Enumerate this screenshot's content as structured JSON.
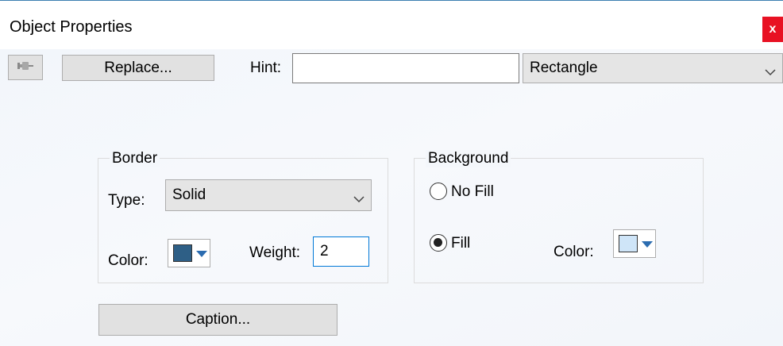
{
  "window": {
    "title": "Object Properties",
    "close_label": "x"
  },
  "toolbar": {
    "pin_icon": "pin-icon",
    "replace_label": "Replace...",
    "hint_label": "Hint:",
    "hint_value": "",
    "shape_value": "Rectangle"
  },
  "border": {
    "legend": "Border",
    "type_label": "Type:",
    "type_value": "Solid",
    "color_label": "Color:",
    "color_value": "#2e5f86",
    "weight_label": "Weight:",
    "weight_value": "2"
  },
  "background": {
    "legend": "Background",
    "no_fill_label": "No Fill",
    "fill_label": "Fill",
    "selected": "Fill",
    "color_label": "Color:",
    "color_value": "#cfe5f8"
  },
  "caption_label": "Caption...",
  "colors": {
    "close_bg": "#e81123",
    "accent": "#0078d7",
    "dropdown_arrow": "#2b6cb0"
  }
}
